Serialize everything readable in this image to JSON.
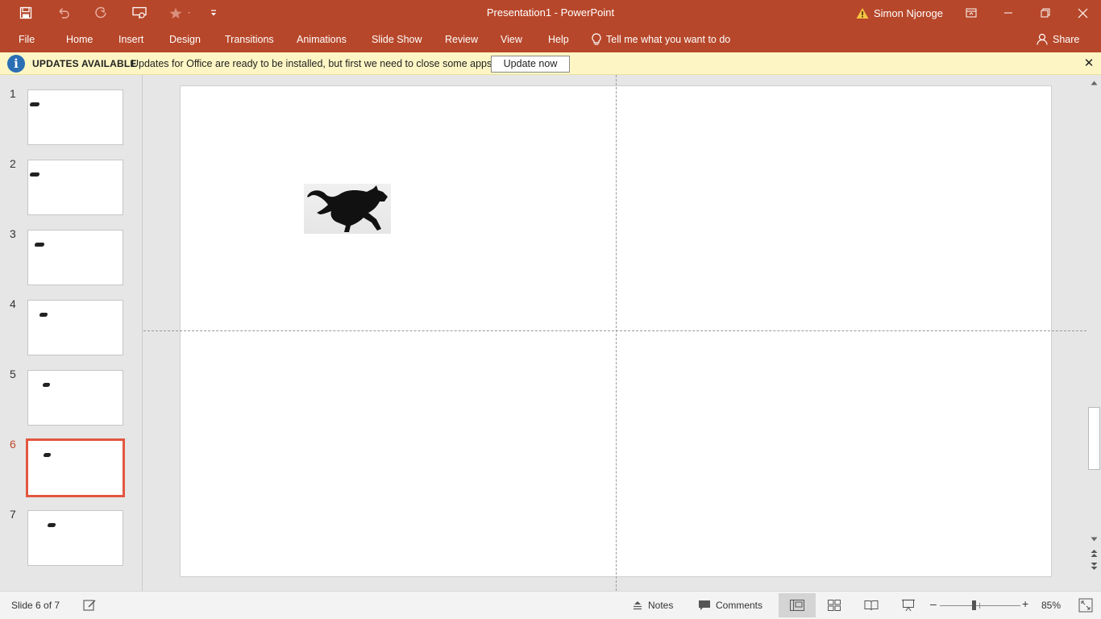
{
  "window": {
    "title": "Presentation1  -  PowerPoint",
    "user_name": "Simon Njoroge",
    "accent_color": "#b7472a"
  },
  "quick_access": [
    "save-icon",
    "undo-icon",
    "redo-icon",
    "present-from-beginning-icon",
    "favorite-star-icon",
    "customize-toolbar-icon"
  ],
  "ribbon": {
    "tabs": [
      "File",
      "Home",
      "Insert",
      "Design",
      "Transitions",
      "Animations",
      "Slide Show",
      "Review",
      "View",
      "Help"
    ],
    "tell_me": "Tell me what you want to do",
    "share": "Share"
  },
  "message_bar": {
    "title": "UPDATES AVAILABLE",
    "text": "Updates for Office are ready to be installed, but first we need to close some apps.",
    "button": "Update now"
  },
  "slides": {
    "numbers": [
      "1",
      "2",
      "3",
      "4",
      "5",
      "6",
      "7"
    ],
    "active_index": 6
  },
  "status": {
    "slide_text": "Slide 6 of 7",
    "notes": "Notes",
    "comments": "Comments",
    "zoom": "85%",
    "zoom_percent": 85
  }
}
